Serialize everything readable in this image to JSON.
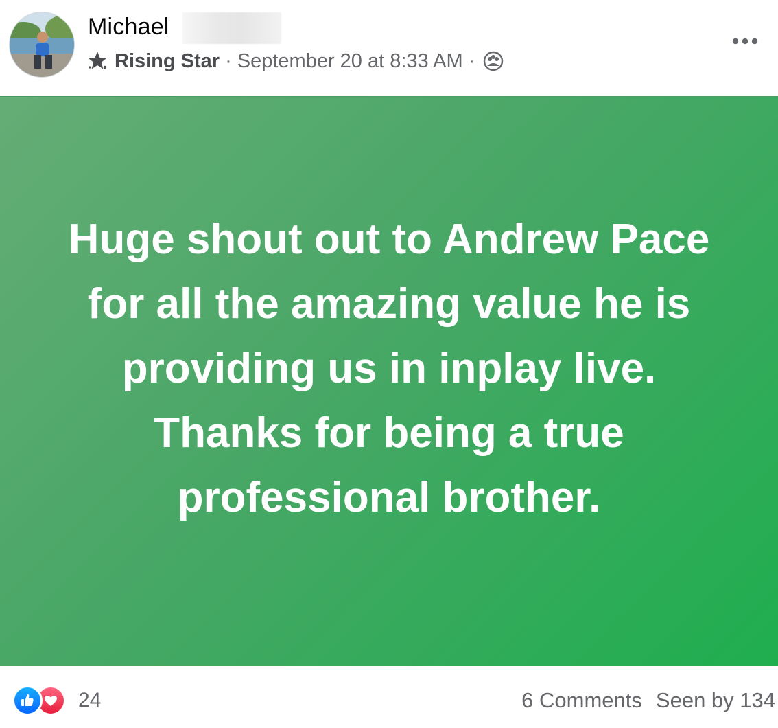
{
  "post": {
    "author": {
      "name": "Michael",
      "badge": "Rising Star"
    },
    "timestamp": "September 20 at 8:33 AM",
    "separator": "·",
    "icons": {
      "badge": "star-icon",
      "audience": "group-audience-icon",
      "more": "more-options-icon"
    },
    "text_lines": [
      "Huge shout out to Andrew Pace",
      "for all the amazing value he is",
      "providing us in inplay live.",
      "Thanks for being a true",
      "professional brother."
    ],
    "background_colors": [
      "#65ad76",
      "#1fae4f"
    ],
    "reactions": {
      "types": [
        "like",
        "love"
      ],
      "count": "24"
    },
    "comments": "6 Comments",
    "seen_by": "Seen by 134"
  }
}
